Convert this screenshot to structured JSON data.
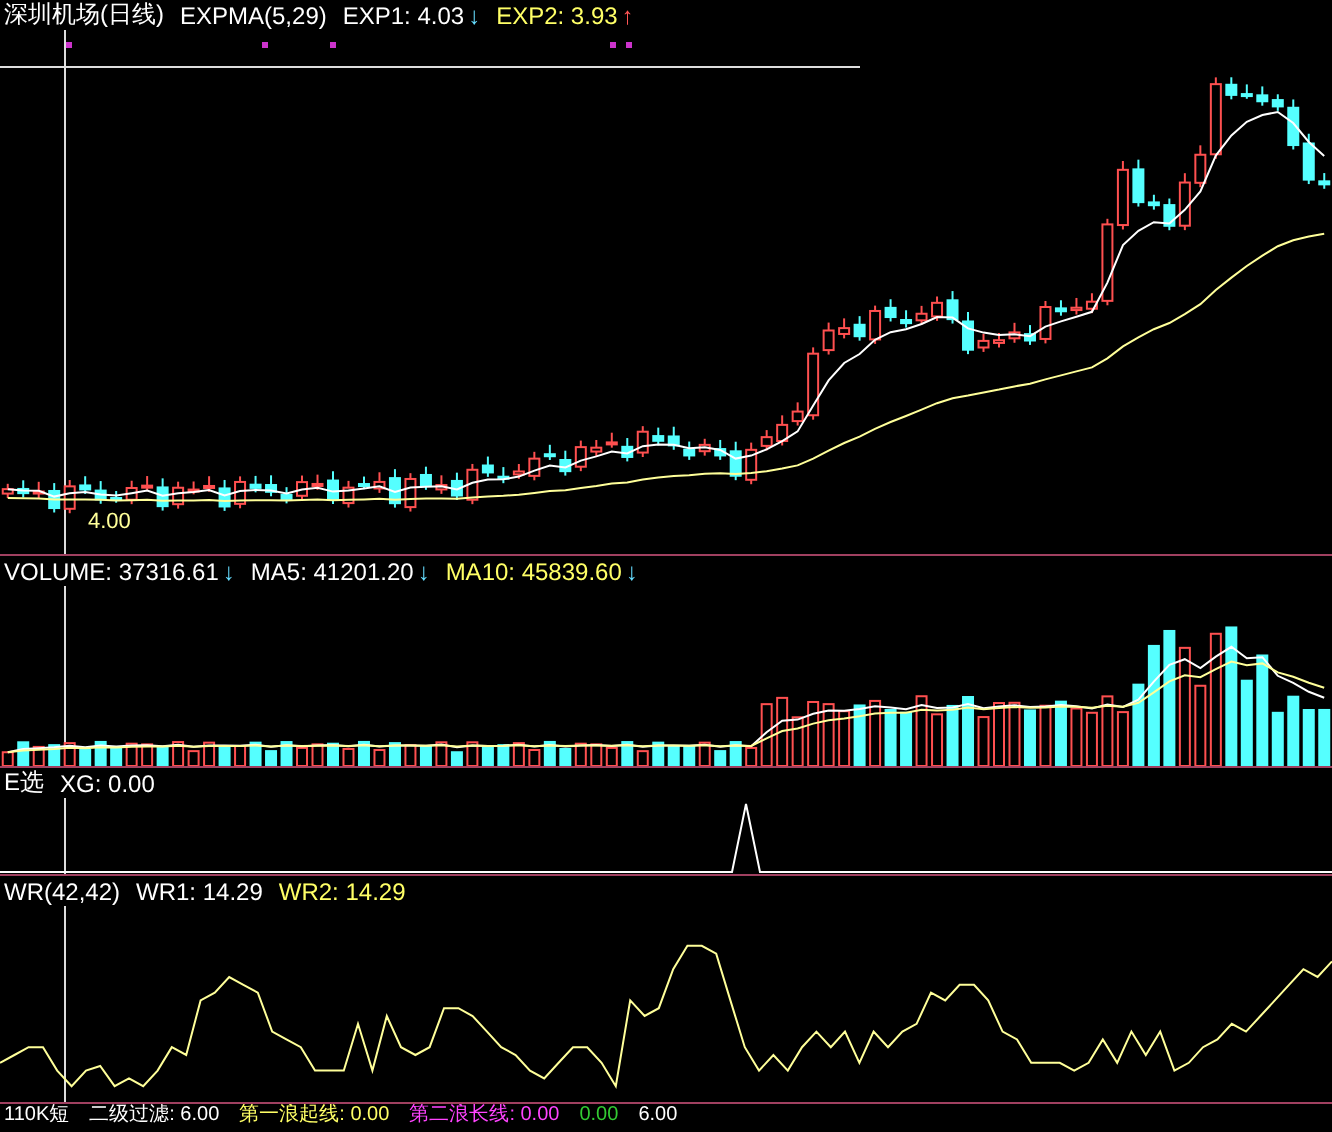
{
  "panes": [
    {
      "kind": "price",
      "title": "深圳机场(日线)",
      "indicator": "EXPMA(5,29)",
      "values": [
        {
          "label": "EXP1: 4.03",
          "color": "#ffffff",
          "arrow": {
            "glyph": "↓",
            "color": "#66ddff"
          }
        },
        {
          "label": "EXP2: 3.93",
          "color": "#ffff66",
          "arrow": {
            "glyph": "↑",
            "color": "#ff5555"
          }
        }
      ],
      "price_label": "4.00"
    },
    {
      "kind": "volume",
      "title": "VOLUME: 37316.61",
      "title_arrow": {
        "glyph": "↓",
        "color": "#66ddff"
      },
      "values": [
        {
          "label": "MA5: 41201.20",
          "color": "#ffffff",
          "arrow": {
            "glyph": "↓",
            "color": "#66ddff"
          }
        },
        {
          "label": "MA10: 45839.60",
          "color": "#ffff66",
          "arrow": {
            "glyph": "↓",
            "color": "#66ddff"
          }
        }
      ]
    },
    {
      "kind": "signal",
      "title": "E选",
      "values": [
        {
          "label": "XG: 0.00",
          "color": "#ffffff"
        }
      ]
    },
    {
      "kind": "wr",
      "title": "WR(42,42)",
      "values": [
        {
          "label": "WR1: 14.29",
          "color": "#ffffff"
        },
        {
          "label": "WR2: 14.29",
          "color": "#ffff66"
        }
      ]
    }
  ],
  "footer": [
    {
      "label": "110K短",
      "color": "#ffffff"
    },
    {
      "label": "二级过滤: 6.00",
      "color": "#ffffff"
    },
    {
      "label": "第一浪起线: 0.00",
      "color": "#ffff66"
    },
    {
      "label": "第二浪长线: 0.00",
      "color": "#ff44ff"
    },
    {
      "label": "0.00",
      "color": "#33cc33"
    },
    {
      "label": "6.00",
      "color": "#ffffff"
    }
  ]
}
